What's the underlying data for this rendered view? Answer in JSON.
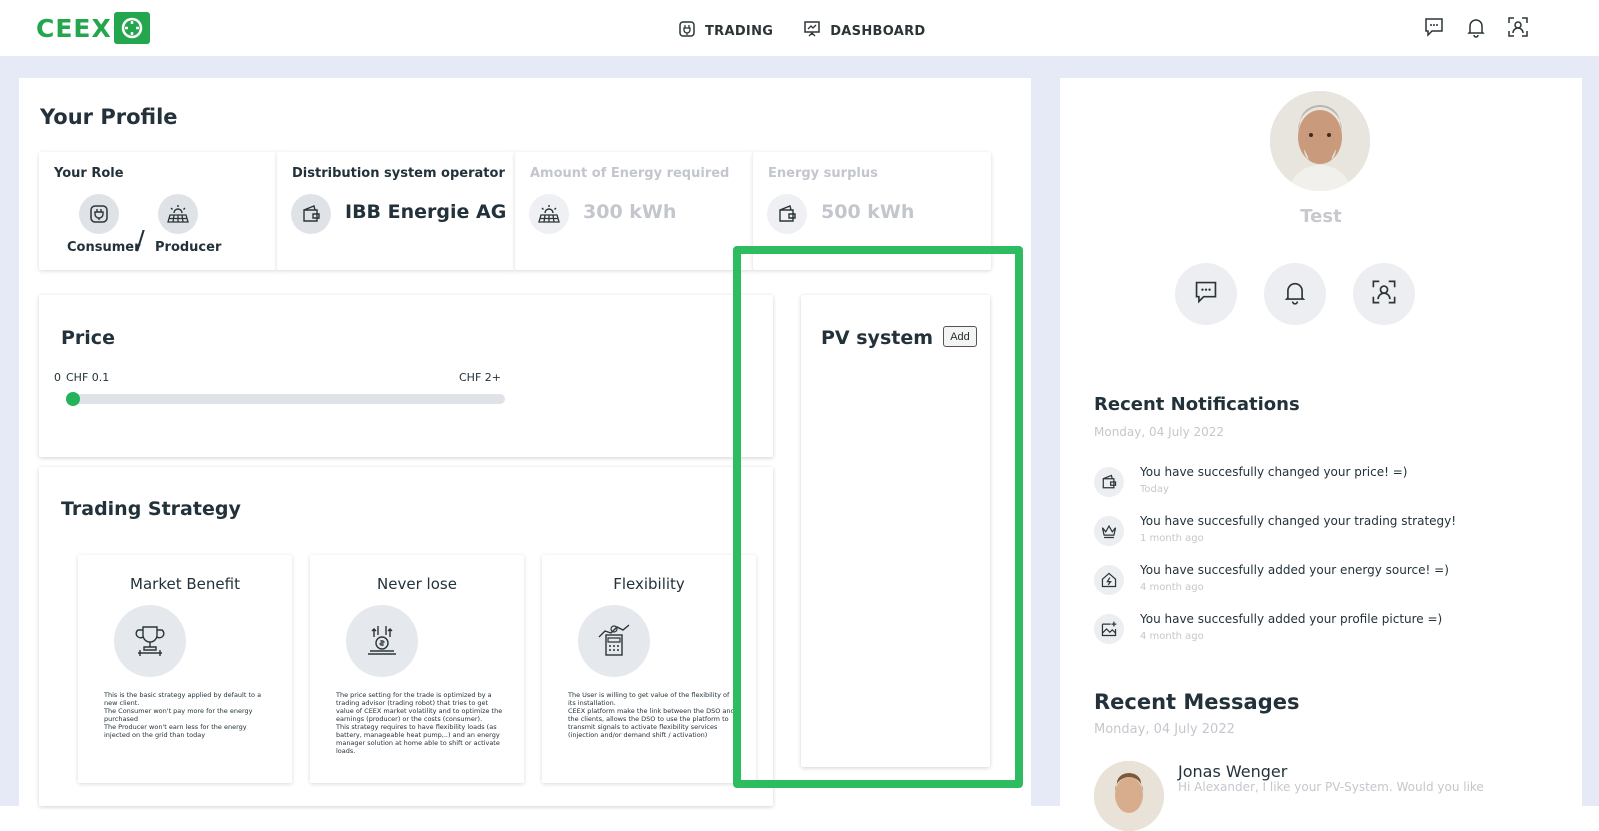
{
  "app": {
    "logo_text": "CEEX",
    "brand_color": "#23a64d",
    "highlight_color": "#2dbd60"
  },
  "nav": {
    "trading_label": "TRADING",
    "dashboard_label": "DASHBOARD"
  },
  "profile": {
    "title": "Your Profile",
    "role": {
      "label": "Your Role",
      "consumer": "Consumer",
      "slash": "/",
      "producer": "Producer"
    },
    "dso": {
      "label": "Distribution system operator",
      "value": "IBB Energie AG"
    },
    "energy_required": {
      "label": "Amount of Energy required",
      "value": "300 kWh"
    },
    "energy_surplus": {
      "label": "Energy surplus",
      "value": "500 kWh"
    }
  },
  "price": {
    "title": "Price",
    "zero": "0",
    "min_label": "CHF 0.1",
    "max_label": "CHF 2+",
    "slider_fraction": 0.0
  },
  "pv": {
    "title": "PV system",
    "add_label": "Add"
  },
  "strategy": {
    "title": "Trading Strategy",
    "cards": [
      {
        "title": "Market Benefit",
        "icon": "trophy-icon",
        "desc": "This is the basic strategy applied by default to a new client.\nThe Consumer won't pay more for the energy purchased\nThe Producer won't earn less for the energy injected on the grid than today"
      },
      {
        "title": "Never lose",
        "icon": "money-hand-icon",
        "desc": "The price setting for the trade is optimized by a trading advisor (trading robot) that tries to get value of CEEX market volatility and to optimize the earnings (producer) or the costs (consumer).\nThis strategy requires to have flexibility loads (as battery, manageable heat pump,..) and an energy manager solution at home able to shift or activate loads."
      },
      {
        "title": "Flexibility",
        "icon": "calculator-chart-icon",
        "desc": "The User is willing to get value of the flexibility of its installation.\nCEEX platform make the link between the DSO and the clients, allows the DSO to use the platform to transmit signals to activate flexibility services (injection and/or demand shift / activation)"
      }
    ]
  },
  "user": {
    "name": "Test"
  },
  "notifications": {
    "title": "Recent Notifications",
    "date": "Monday, 04 July 2022",
    "items": [
      {
        "icon": "wallet-icon",
        "text": "You have succesfully changed your price! =)",
        "time": "Today"
      },
      {
        "icon": "crown-icon",
        "text": "You have succesfully changed your trading strategy!",
        "time": "1 month ago"
      },
      {
        "icon": "house-energy-icon",
        "text": "You have succesfully added your energy source! =)",
        "time": "4 month ago"
      },
      {
        "icon": "image-add-icon",
        "text": "You have succesfully added your profile picture =)",
        "time": "4 month ago"
      }
    ]
  },
  "messages": {
    "title": "Recent Messages",
    "date": "Monday, 04 July 2022",
    "items": [
      {
        "name": "Jonas Wenger",
        "text": "Hi Alexander, I like your PV-System. Would you like"
      }
    ]
  }
}
